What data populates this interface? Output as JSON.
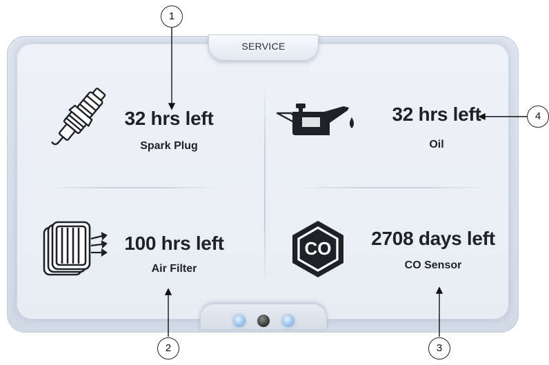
{
  "header": {
    "tab_label": "SERVICE"
  },
  "items": [
    {
      "value": "32 hrs left",
      "label": "Spark Plug",
      "icon": "spark-plug-icon"
    },
    {
      "value": "32 hrs left",
      "label": "Oil",
      "icon": "oil-can-icon"
    },
    {
      "value": "100 hrs left",
      "label": "Air Filter",
      "icon": "air-filter-icon"
    },
    {
      "value": "2708 days left",
      "label": "CO Sensor",
      "icon": "co-sensor-icon",
      "icon_text": "CO"
    }
  ],
  "pagination": {
    "pages": 3,
    "active_index": 1
  },
  "callouts": [
    "1",
    "2",
    "3",
    "4"
  ]
}
